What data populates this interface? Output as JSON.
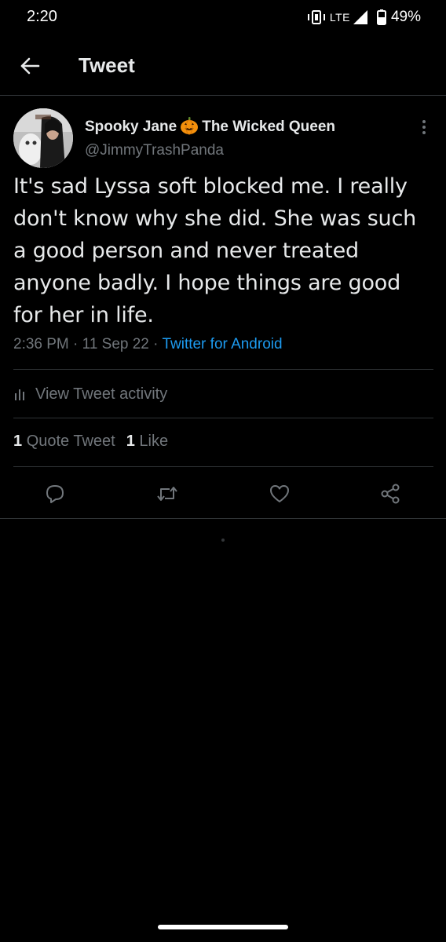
{
  "status_bar": {
    "time": "2:20",
    "network": "LTE",
    "battery": "49%"
  },
  "header": {
    "title": "Tweet"
  },
  "tweet": {
    "author_name_part1": "Spooky Jane",
    "author_name_part2": "The Wicked Queen",
    "author_handle": "@JimmyTrashPanda",
    "text": "It's sad Lyssa soft blocked me. I really don't know why she did. She was such a good person and never treated anyone badly. I hope things are good for her in life.",
    "time": "2:36 PM",
    "date": "11 Sep 22",
    "separator": "·",
    "source": "Twitter for Android"
  },
  "activity": {
    "label": "View Tweet activity"
  },
  "stats": {
    "quote_count": "1",
    "quote_label": "Quote Tweet",
    "like_count": "1",
    "like_label": "Like"
  },
  "icons": {
    "back": "back-arrow-icon",
    "more": "more-vertical-icon",
    "reply": "reply-icon",
    "retweet": "retweet-icon",
    "like": "heart-icon",
    "share": "share-icon",
    "emoji": "pumpkin-emoji-icon"
  },
  "colors": {
    "background": "#000000",
    "text_primary": "#e7e9ea",
    "text_secondary": "#71767b",
    "link": "#1d9bf0",
    "divider": "#2f3336"
  }
}
